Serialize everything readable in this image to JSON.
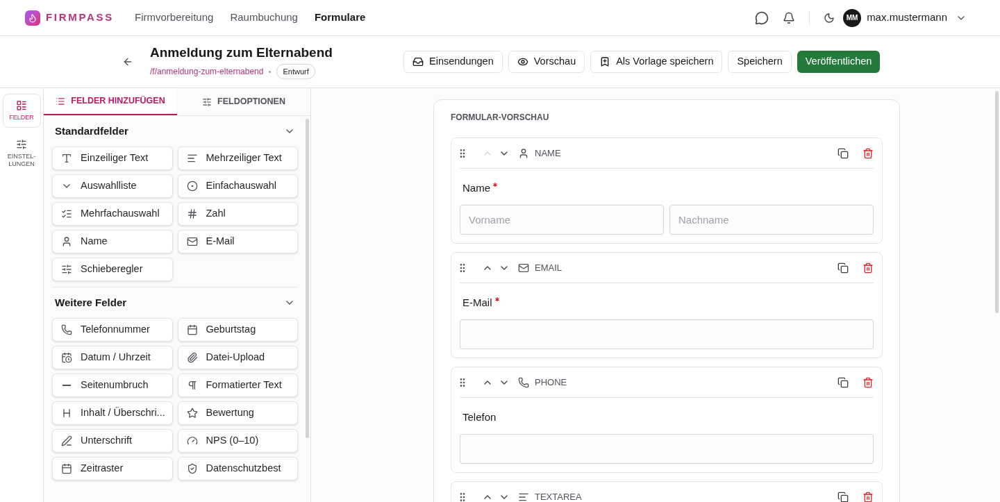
{
  "brand": "FIRMPASS",
  "nav": [
    {
      "label": "Firmvorbereitung",
      "selected": false
    },
    {
      "label": "Raumbuchung",
      "selected": false
    },
    {
      "label": "Formulare",
      "selected": true
    }
  ],
  "user": {
    "initials": "MM",
    "name": "max.mustermann"
  },
  "form": {
    "title": "Anmeldung zum Elternabend",
    "slug": "/f/anmeldung-zum-elternabend",
    "status": "Entwurf"
  },
  "actions": [
    {
      "label": "Einsendungen",
      "kind": "inbox"
    },
    {
      "label": "Vorschau",
      "kind": "eye"
    },
    {
      "label": "Als Vorlage speichern",
      "kind": "bookmark"
    },
    {
      "label": "Speichern",
      "kind": "plain"
    },
    {
      "label": "Veröffentlichen",
      "kind": "primary"
    }
  ],
  "rail": [
    {
      "label": "FELDER",
      "selected": true,
      "kind": "fields"
    },
    {
      "label": "EINSTEL-\nLUNGEN",
      "selected": false,
      "kind": "settings"
    }
  ],
  "panel_tabs": [
    {
      "label": "FELDER HINZUFÜGEN",
      "selected": true,
      "kind": "list"
    },
    {
      "label": "FELDOPTIONEN",
      "selected": false,
      "kind": "sliders"
    }
  ],
  "sections": [
    {
      "title": "Standardfelder",
      "expanded": true,
      "items": [
        {
          "label": "Einzeiliger Text",
          "kind": "type"
        },
        {
          "label": "Mehrzeiliger Text",
          "kind": "lines"
        },
        {
          "label": "Auswahlliste",
          "kind": "chevron"
        },
        {
          "label": "Einfachauswahl",
          "kind": "radio"
        },
        {
          "label": "Mehrfachauswahl",
          "kind": "checklist"
        },
        {
          "label": "Zahl",
          "kind": "hash"
        },
        {
          "label": "Name",
          "kind": "user"
        },
        {
          "label": "E-Mail",
          "kind": "mail"
        },
        {
          "label": "Schieberegler",
          "kind": "sliders"
        }
      ]
    },
    {
      "title": "Weitere Felder",
      "expanded": true,
      "items": [
        {
          "label": "Telefonnummer",
          "kind": "phone"
        },
        {
          "label": "Geburtstag",
          "kind": "calendar"
        },
        {
          "label": "Datum / Uhrzeit",
          "kind": "calclock"
        },
        {
          "label": "Datei-Upload",
          "kind": "clip"
        },
        {
          "label": "Seitenumbruch",
          "kind": "minus"
        },
        {
          "label": "Formatierter Text",
          "kind": "pilcrow"
        },
        {
          "label": "Inhalt / Überschri...",
          "kind": "heading"
        },
        {
          "label": "Bewertung",
          "kind": "star"
        },
        {
          "label": "Unterschrift",
          "kind": "pen"
        },
        {
          "label": "NPS (0–10)",
          "kind": "gauge"
        },
        {
          "label": "Zeitraster",
          "kind": "calendar"
        },
        {
          "label": "Datenschutzbest",
          "kind": "shield"
        }
      ]
    }
  ],
  "preview": {
    "title": "FORMULAR-VORSCHAU",
    "fields": [
      {
        "type_label": "NAME",
        "kind": "name",
        "can_move_up": false,
        "label": "Name",
        "required": true,
        "placeholders": [
          "Vorname",
          "Nachname"
        ]
      },
      {
        "type_label": "EMAIL",
        "kind": "email",
        "can_move_up": true,
        "label": "E-Mail",
        "required": true
      },
      {
        "type_label": "PHONE",
        "kind": "phone",
        "can_move_up": true,
        "label": "Telefon",
        "required": false
      },
      {
        "type_label": "TEXTAREA",
        "kind": "textarea",
        "can_move_up": true
      }
    ]
  }
}
